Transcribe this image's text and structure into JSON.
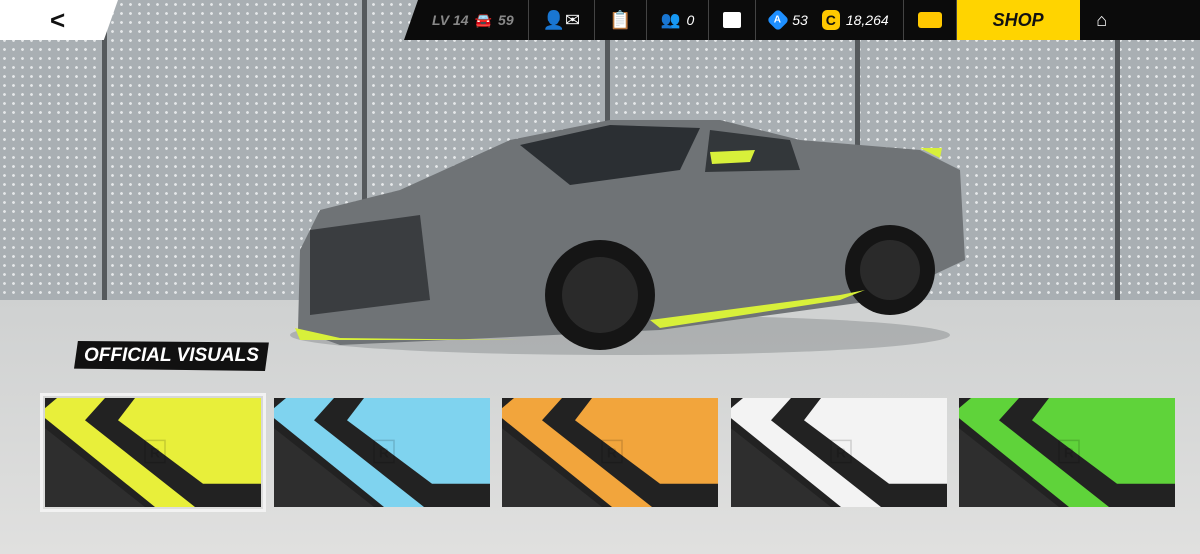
{
  "back_label": "<",
  "topbar": {
    "level": "LV 14",
    "cars": "59",
    "friends": "0",
    "a_currency": "53",
    "a_label": "A",
    "c_currency": "18,264",
    "c_label": "C",
    "shop": "SHOP"
  },
  "section_label": "OFFICIAL VISUALS",
  "swatches": [
    {
      "name": "yellow",
      "color": "#e8ef3a",
      "selected": true
    },
    {
      "name": "blue",
      "color": "#7fd3ef",
      "selected": false
    },
    {
      "name": "orange",
      "color": "#f2a53c",
      "selected": false
    },
    {
      "name": "white",
      "color": "#f3f3f3",
      "selected": false
    },
    {
      "name": "green",
      "color": "#5fd33a",
      "selected": false
    }
  ],
  "watermark": "R"
}
